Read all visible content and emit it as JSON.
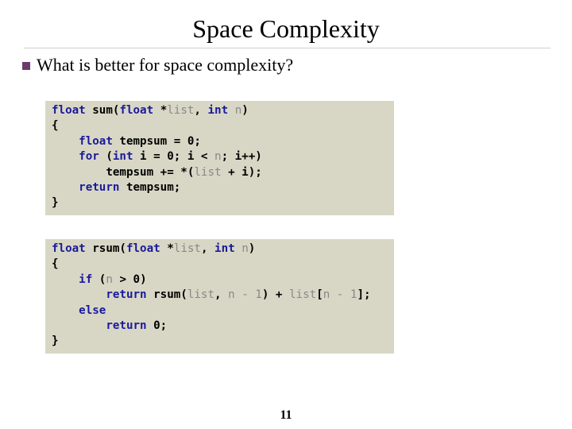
{
  "slide": {
    "title": "Space Complexity",
    "bullet": "What is better for space complexity?",
    "page_number": "11",
    "colors": {
      "bullet": "#6b3a6b",
      "code_bg": "#d8d7c6",
      "keyword": "#1a1a9a",
      "identifier_param": "#888888"
    }
  },
  "code_blocks": [
    {
      "name": "sum",
      "lines": [
        [
          {
            "t": "float",
            "k": "kw"
          },
          {
            "t": " sum(",
            "k": ""
          },
          {
            "t": "float",
            "k": "kw"
          },
          {
            "t": " *",
            "k": ""
          },
          {
            "t": "list",
            "k": "gr"
          },
          {
            "t": ", ",
            "k": ""
          },
          {
            "t": "int",
            "k": "kw"
          },
          {
            "t": " ",
            "k": ""
          },
          {
            "t": "n",
            "k": "gr"
          },
          {
            "t": ")",
            "k": ""
          }
        ],
        [
          {
            "t": "{",
            "k": ""
          }
        ],
        [
          {
            "t": "    ",
            "k": ""
          },
          {
            "t": "float",
            "k": "kw"
          },
          {
            "t": " tempsum = 0;",
            "k": ""
          }
        ],
        [
          {
            "t": "    ",
            "k": ""
          },
          {
            "t": "for",
            "k": "kw"
          },
          {
            "t": " (",
            "k": ""
          },
          {
            "t": "int",
            "k": "kw"
          },
          {
            "t": " i = 0; i < ",
            "k": ""
          },
          {
            "t": "n",
            "k": "gr"
          },
          {
            "t": "; i++)",
            "k": ""
          }
        ],
        [
          {
            "t": "        tempsum += *(",
            "k": ""
          },
          {
            "t": "list",
            "k": "gr"
          },
          {
            "t": " + i);",
            "k": ""
          }
        ],
        [
          {
            "t": "    ",
            "k": ""
          },
          {
            "t": "return",
            "k": "kw"
          },
          {
            "t": " tempsum;",
            "k": ""
          }
        ],
        [
          {
            "t": "}",
            "k": ""
          }
        ]
      ]
    },
    {
      "name": "rsum",
      "lines": [
        [
          {
            "t": "float",
            "k": "kw"
          },
          {
            "t": " rsum(",
            "k": ""
          },
          {
            "t": "float",
            "k": "kw"
          },
          {
            "t": " *",
            "k": ""
          },
          {
            "t": "list",
            "k": "gr"
          },
          {
            "t": ", ",
            "k": ""
          },
          {
            "t": "int",
            "k": "kw"
          },
          {
            "t": " ",
            "k": ""
          },
          {
            "t": "n",
            "k": "gr"
          },
          {
            "t": ")",
            "k": ""
          }
        ],
        [
          {
            "t": "{",
            "k": ""
          }
        ],
        [
          {
            "t": "    ",
            "k": ""
          },
          {
            "t": "if",
            "k": "kw"
          },
          {
            "t": " (",
            "k": ""
          },
          {
            "t": "n",
            "k": "gr"
          },
          {
            "t": " > 0)",
            "k": ""
          }
        ],
        [
          {
            "t": "        ",
            "k": ""
          },
          {
            "t": "return",
            "k": "kw"
          },
          {
            "t": " rsum(",
            "k": ""
          },
          {
            "t": "list",
            "k": "gr"
          },
          {
            "t": ", ",
            "k": ""
          },
          {
            "t": "n - 1",
            "k": "gr"
          },
          {
            "t": ") + ",
            "k": ""
          },
          {
            "t": "list",
            "k": "gr"
          },
          {
            "t": "[",
            "k": ""
          },
          {
            "t": "n - 1",
            "k": "gr"
          },
          {
            "t": "];",
            "k": ""
          }
        ],
        [
          {
            "t": "    ",
            "k": ""
          },
          {
            "t": "else",
            "k": "kw"
          }
        ],
        [
          {
            "t": "        ",
            "k": ""
          },
          {
            "t": "return",
            "k": "kw"
          },
          {
            "t": " 0;",
            "k": ""
          }
        ],
        [
          {
            "t": "}",
            "k": ""
          }
        ]
      ]
    }
  ]
}
